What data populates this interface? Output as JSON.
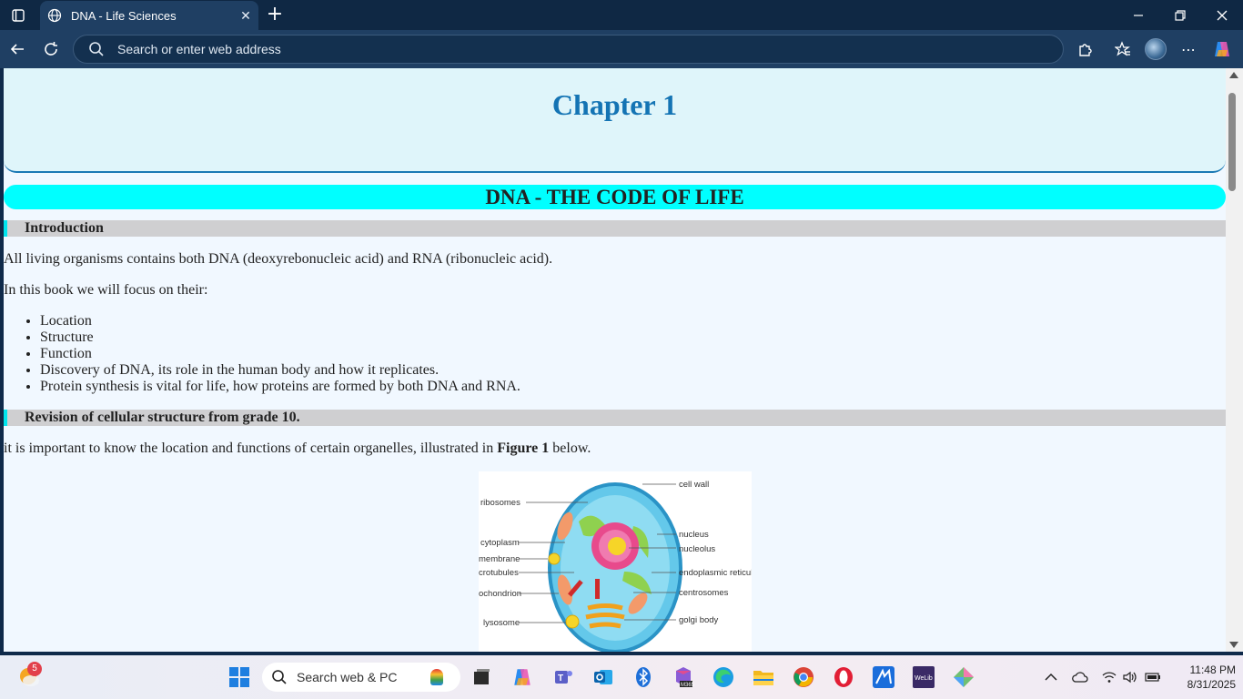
{
  "browser": {
    "tab_title": "DNA - Life Sciences",
    "address_placeholder": "Search or enter web address"
  },
  "page": {
    "chapter_title": "Chapter 1",
    "banner": "DNA - THE CODE OF LIFE",
    "section1": "Introduction",
    "intro_para1": "All living organisms contains both DNA (deoxyrebonucleic acid) and RNA (ribonucleic acid).",
    "intro_para2": "In this book we will focus on their:",
    "bullets": [
      "Location",
      "Structure",
      "Function",
      "Discovery of DNA, its role in the human body and how it replicates.",
      "Protein synthesis is vital for life, how proteins are formed by both DNA and RNA."
    ],
    "section2": "Revision of cellular structure from grade 10.",
    "revision_para_before": "it is important to know the location and functions of certain organelles, illustrated in ",
    "revision_para_bold": "Figure 1",
    "revision_para_after": " below.",
    "figure_labels": {
      "cell_wall": "cell wall",
      "ribosomes": "ribosomes",
      "nucleus": "nucleus",
      "nucleolus": "nucleolus",
      "cytoplasm": "cytoplasm",
      "membrane": "membrane",
      "microtubules": "crotubules",
      "endoplasmic": "endoplasmic reticulu",
      "mitochondrion": "ochondrion",
      "centrosomes": "centrosomes",
      "lysosome": "lysosome",
      "golgi": "golgi body"
    }
  },
  "taskbar": {
    "weather_badge": "5",
    "search_placeholder": "Search web & PC",
    "time": "11:48 PM",
    "date": "8/31/2025"
  }
}
